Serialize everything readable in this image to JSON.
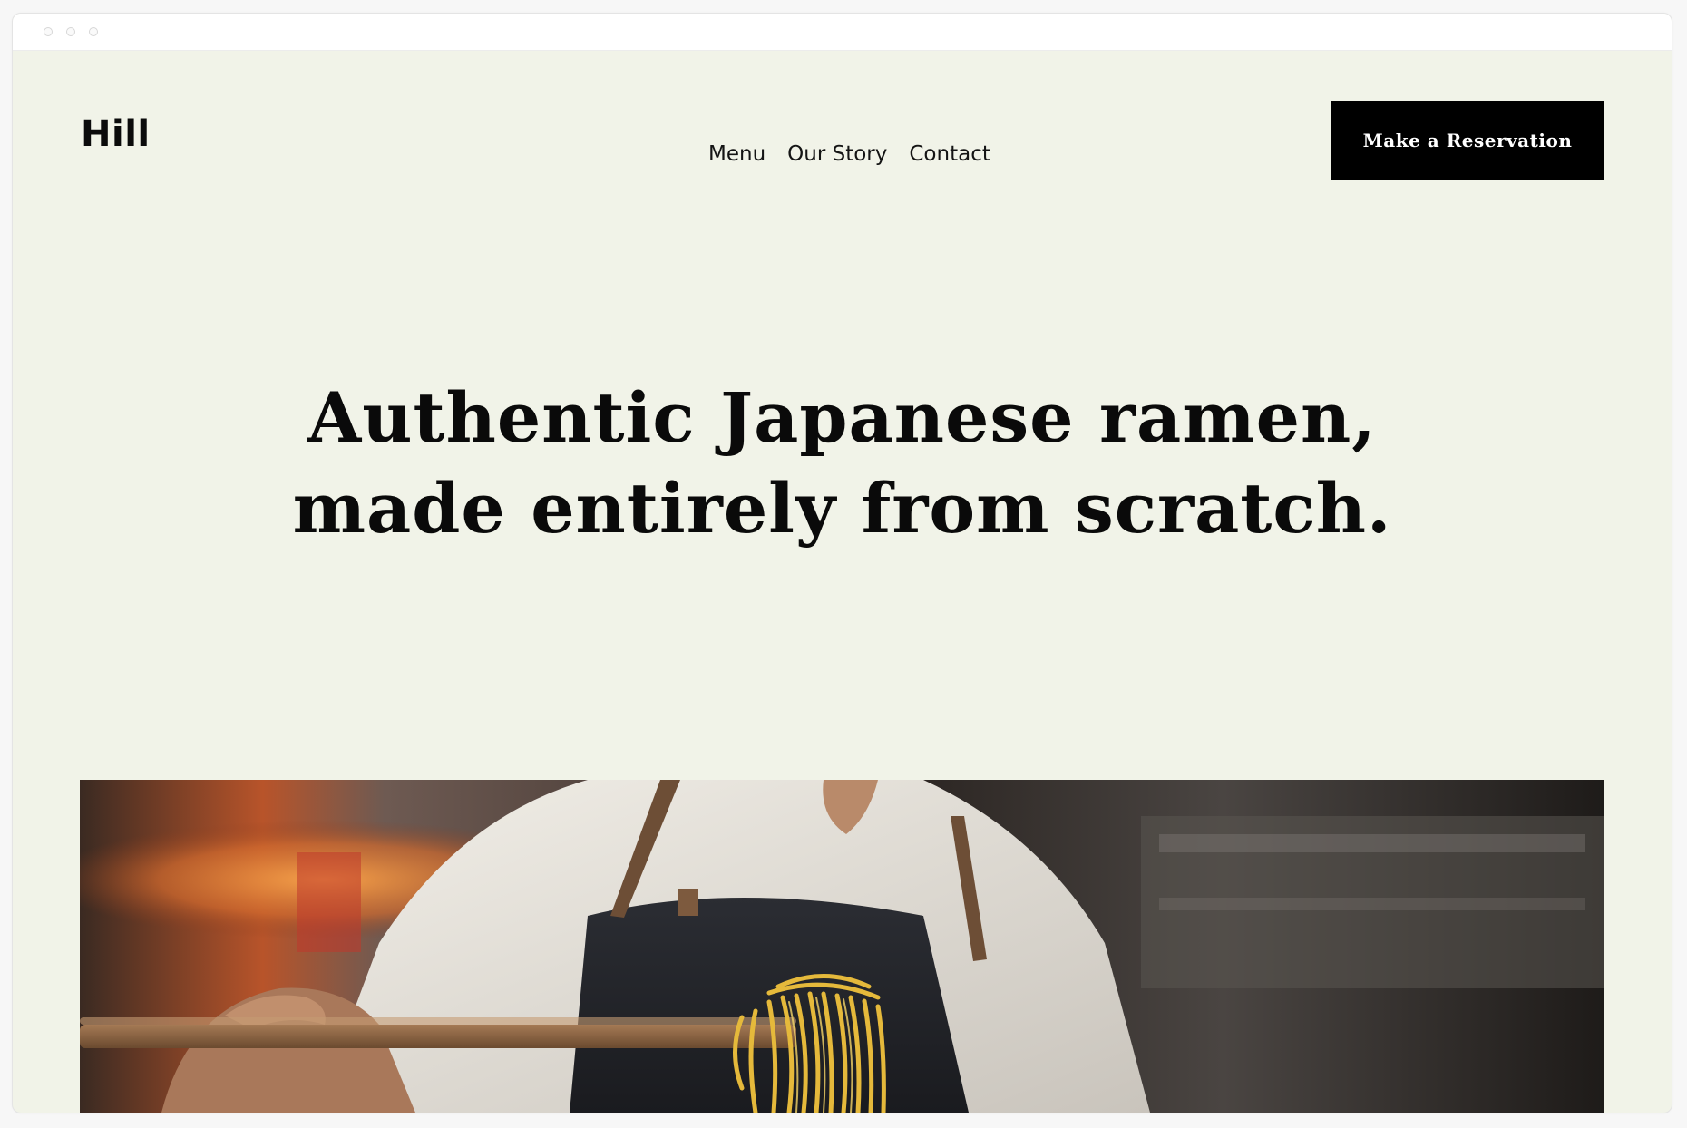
{
  "brand": {
    "logo_text": "Hill"
  },
  "nav": {
    "items": [
      {
        "label": "Menu"
      },
      {
        "label": "Our Story"
      },
      {
        "label": "Contact"
      }
    ]
  },
  "cta": {
    "label": "Make a Reservation"
  },
  "hero": {
    "headline_line1": "Authentic Japanese ramen,",
    "headline_line2": "made entirely from scratch."
  },
  "colors": {
    "page_background": "#f1f3e8",
    "text": "#0a0a0a",
    "button_background": "#000000",
    "button_text": "#ffffff"
  }
}
